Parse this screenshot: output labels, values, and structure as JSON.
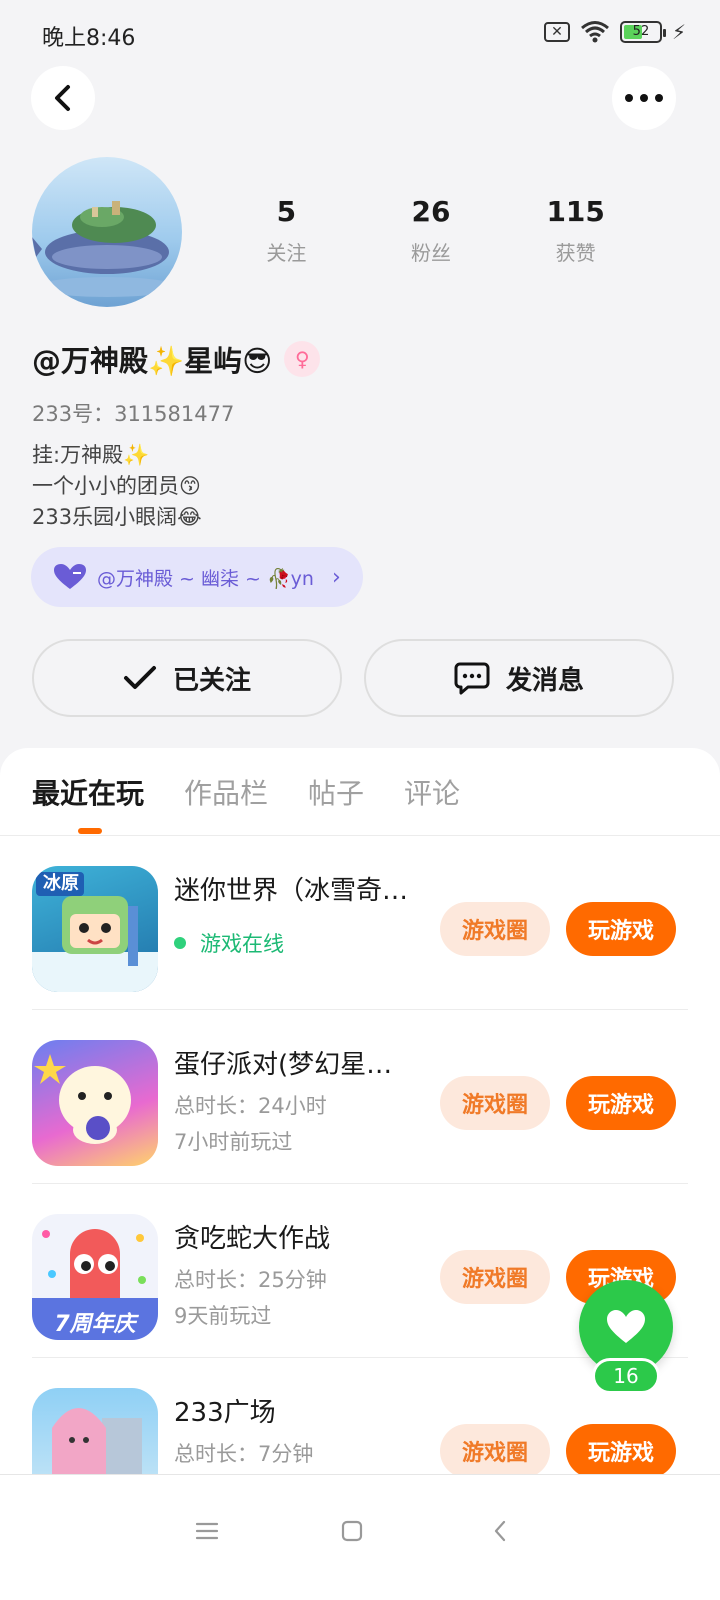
{
  "status_bar": {
    "time": "晚上8:46",
    "battery": "52"
  },
  "profile": {
    "stats": [
      {
        "value": "5",
        "label": "关注"
      },
      {
        "value": "26",
        "label": "粉丝"
      },
      {
        "value": "115",
        "label": "获赞"
      }
    ],
    "nickname": "@万神殿✨星屿😎",
    "uid": "233号：311581477",
    "bio": [
      "挂:万神殿✨",
      "一个小小的团员😙",
      "233乐园小眼阔😂"
    ],
    "guild": "@万神殿 ~ 幽柒 ~ 🥀yn",
    "follow_label": "已关注",
    "message_label": "发消息"
  },
  "tabs": [
    "最近在玩",
    "作品栏",
    "帖子",
    "评论"
  ],
  "games": [
    {
      "name": "迷你世界（冰雪奇…",
      "status": "游戏在线",
      "circle_label": "游戏圈",
      "play_label": "玩游戏"
    },
    {
      "name": "蛋仔派对(梦幻星…",
      "duration": "总时长：24小时",
      "last_played": "7小时前玩过",
      "circle_label": "游戏圈",
      "play_label": "玩游戏"
    },
    {
      "name": "贪吃蛇大作战",
      "duration": "总时长：25分钟",
      "last_played": "9天前玩过",
      "circle_label": "游戏圈",
      "play_label": "玩游戏",
      "icon_text": "7周年庆"
    },
    {
      "name": "233广场",
      "duration": "总时长：7分钟",
      "circle_label": "游戏圈",
      "play_label": "玩游戏"
    }
  ],
  "icon_texts": {
    "game0": "冰原"
  },
  "like_count": "16",
  "colors": {
    "accent": "#ff6a00",
    "online": "#1cb974",
    "like": "#2cc94a",
    "guild": "#6a5cd6"
  },
  "icons": [
    "back-icon",
    "more-icon",
    "check-icon",
    "chat-icon",
    "heart-icon",
    "menu-icon",
    "home-icon",
    "nav-back-icon"
  ]
}
